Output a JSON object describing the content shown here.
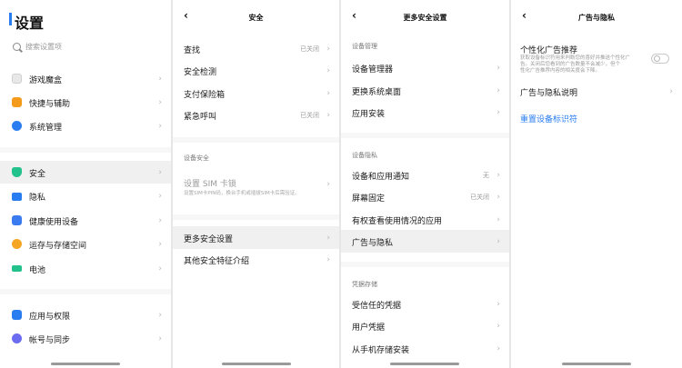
{
  "screen1": {
    "title": "设置",
    "search_placeholder": "搜索设置项",
    "group1": [
      {
        "label": "游戏魔盒",
        "icon": "game-box-icon",
        "color": "#e8e8e8"
      },
      {
        "label": "快捷与辅助",
        "icon": "shortcut-assist-icon",
        "color": "#f49b1c"
      },
      {
        "label": "系统管理",
        "icon": "system-management-icon",
        "color": "#2a7df0"
      }
    ],
    "group2": [
      {
        "label": "安全",
        "icon": "shield-icon",
        "color": "#23c18c"
      },
      {
        "label": "隐私",
        "icon": "lock-icon",
        "color": "#2a7df0"
      },
      {
        "label": "健康使用设备",
        "icon": "health-icon",
        "color": "#3a7cf0"
      },
      {
        "label": "运存与存储空间",
        "icon": "storage-icon",
        "color": "#f5a623"
      },
      {
        "label": "电池",
        "icon": "battery-icon",
        "color": "#23c18c"
      }
    ],
    "group3": [
      {
        "label": "应用与权限",
        "icon": "apps-grid-icon",
        "color": "#2a7df0"
      },
      {
        "label": "帐号与同步",
        "icon": "account-icon",
        "color": "#6b6cf0"
      }
    ]
  },
  "screen2": {
    "title": "安全",
    "items": [
      {
        "label": "查找",
        "status": "已关闭"
      },
      {
        "label": "安全检测",
        "status": ""
      },
      {
        "label": "支付保险箱",
        "status": ""
      },
      {
        "label": "紧急呼叫",
        "status": "已关闭"
      }
    ],
    "device_security_label": "设备安全",
    "sim_lock": {
      "label": "设置 SIM 卡锁",
      "subtext": "设置SIM卡PIN码，换台手机或插拔SIM卡后需验证。"
    },
    "items2": [
      {
        "label": "更多安全设置"
      },
      {
        "label": "其他安全特征介绍"
      }
    ]
  },
  "screen3": {
    "title": "更多安全设置",
    "section1_label": "设备管理",
    "section1": [
      {
        "label": "设备管理器"
      },
      {
        "label": "更换系统桌面"
      },
      {
        "label": "应用安装"
      }
    ],
    "section2_label": "设备隐私",
    "section2": [
      {
        "label": "设备和应用通知",
        "status": "无"
      },
      {
        "label": "屏幕固定",
        "status": "已关闭"
      },
      {
        "label": "有权查看使用情况的应用",
        "status": ""
      },
      {
        "label": "广告与隐私",
        "status": ""
      }
    ],
    "section3_label": "凭据存储",
    "section3": [
      {
        "label": "受信任的凭据"
      },
      {
        "label": "用户凭据"
      },
      {
        "label": "从手机存储安装"
      }
    ]
  },
  "screen4": {
    "title": "广告与隐私",
    "personalized_ads": {
      "label": "个性化广告推荐",
      "desc_line1": "获取设备标识符用来判断您的喜好并推送个性化广",
      "desc_line2": "告。关闭后您看到的广告数量不会减少，但个",
      "desc_line3": "性化广告推荐内容的相关度会下降。",
      "enabled": false
    },
    "privacy_policy_label": "广告与隐私说明",
    "reset_label": "重置设备标识符"
  }
}
